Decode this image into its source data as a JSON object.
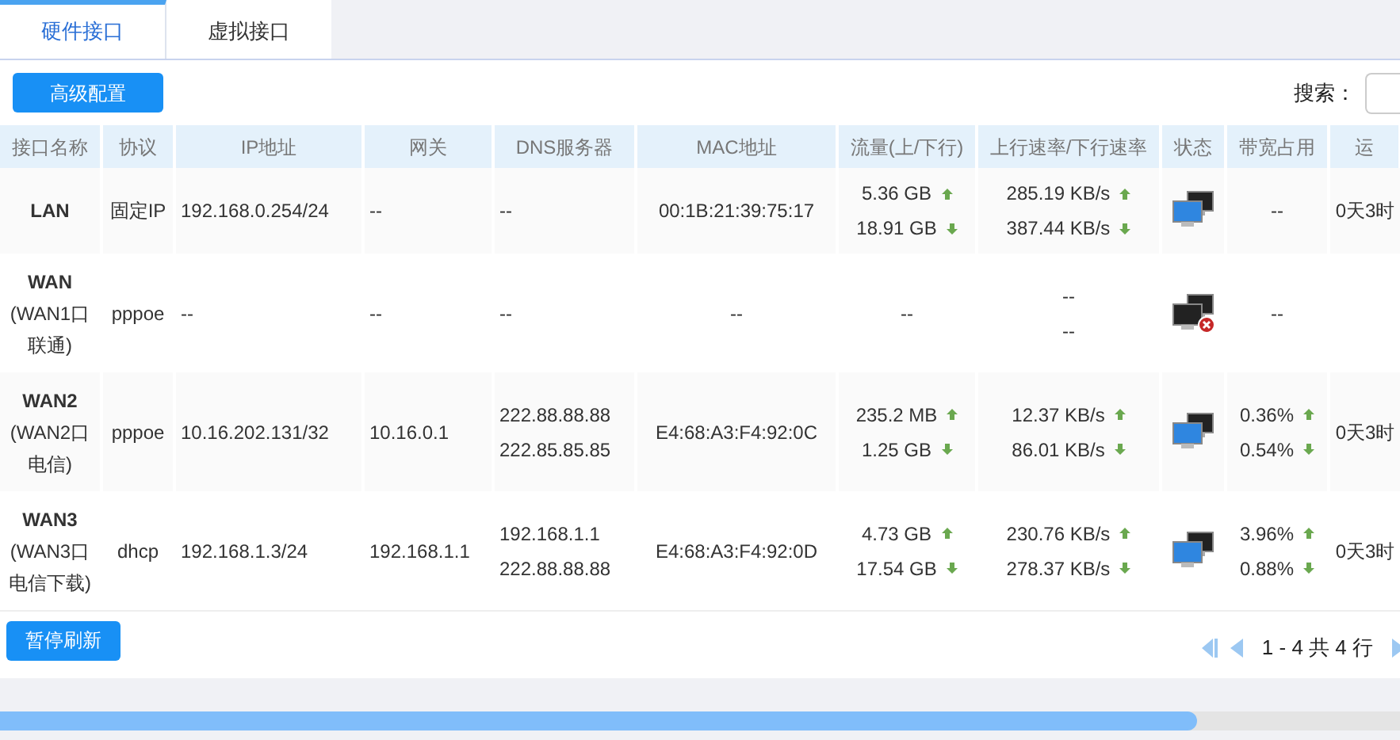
{
  "tabs": [
    {
      "label": "硬件接口",
      "selected": true
    },
    {
      "label": "虚拟接口",
      "selected": false
    }
  ],
  "toolbar": {
    "button": "高级配置",
    "search_label": "搜索："
  },
  "table": {
    "columns": [
      "接口名称",
      "协议",
      "IP地址",
      "网关",
      "DNS服务器",
      "MAC地址",
      "流量(上/下行)",
      "上行速率/下行速率",
      "状态",
      "带宽占用",
      "运"
    ],
    "rows": [
      {
        "name": "LAN",
        "protocol": "固定IP",
        "ip": "192.168.0.254/24",
        "gateway": "--",
        "dns": [
          "--"
        ],
        "mac": "00:1B:21:39:75:17",
        "traffic": [
          {
            "text": "5.36 GB",
            "up": true
          },
          {
            "text": "18.91 GB",
            "up": false
          }
        ],
        "rate": [
          {
            "text": "285.19 KB/s",
            "up": true
          },
          {
            "text": "387.44 KB/s",
            "up": false
          }
        ],
        "connected": true,
        "bandwidth": [
          {
            "text": "--"
          }
        ],
        "uptime": "0天3时"
      },
      {
        "name": "WAN",
        "sub": "(WAN1口联通)",
        "protocol": "pppoe",
        "ip": "--",
        "gateway": "--",
        "dns": [
          "--"
        ],
        "mac": "--",
        "traffic": [
          {
            "text": "--"
          }
        ],
        "rate": [
          {
            "text": "--"
          },
          {
            "text": "--"
          }
        ],
        "connected": false,
        "bandwidth": [
          {
            "text": "--"
          }
        ]
      },
      {
        "name": "WAN2",
        "sub": "(WAN2口电信)",
        "protocol": "pppoe",
        "ip": "10.16.202.131/32",
        "gateway": "10.16.0.1",
        "dns": [
          "222.88.88.88",
          "222.85.85.85"
        ],
        "mac": "E4:68:A3:F4:92:0C",
        "traffic": [
          {
            "text": "235.2 MB",
            "up": true
          },
          {
            "text": "1.25 GB",
            "up": false
          }
        ],
        "rate": [
          {
            "text": "12.37 KB/s",
            "up": true
          },
          {
            "text": "86.01 KB/s",
            "up": false
          }
        ],
        "connected": true,
        "bandwidth": [
          {
            "text": "0.36%",
            "up": true
          },
          {
            "text": "0.54%",
            "up": false
          }
        ],
        "uptime": "0天3时"
      },
      {
        "name": "WAN3",
        "sub": "(WAN3口电信下载)",
        "protocol": "dhcp",
        "ip": "192.168.1.3/24",
        "gateway": "192.168.1.1",
        "dns": [
          "192.168.1.1",
          "222.88.88.88"
        ],
        "mac": "E4:68:A3:F4:92:0D",
        "traffic": [
          {
            "text": "4.73 GB",
            "up": true
          },
          {
            "text": "17.54 GB",
            "up": false
          }
        ],
        "rate": [
          {
            "text": "230.76 KB/s",
            "up": true
          },
          {
            "text": "278.37 KB/s",
            "up": false
          }
        ],
        "connected": true,
        "bandwidth": [
          {
            "text": "3.96%",
            "up": true
          },
          {
            "text": "0.88%",
            "up": false
          }
        ],
        "uptime": "0天3时"
      }
    ]
  },
  "footer": {
    "button": "暂停刷新",
    "pagination": "1 - 4 共 4 行"
  }
}
